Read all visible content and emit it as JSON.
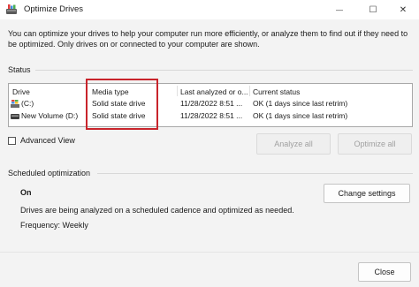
{
  "window": {
    "title": "Optimize Drives",
    "minimize_glyph": "—",
    "maximize_glyph": "☐",
    "close_glyph": "✕"
  },
  "intro_text": "You can optimize your drives to help your computer run more efficiently, or analyze them to find out if they need to be optimized. Only drives on or connected to your computer are shown.",
  "status": {
    "section_label": "Status",
    "columns": [
      "Drive",
      "Media type",
      "Last analyzed or o...",
      "Current status"
    ],
    "rows": [
      {
        "drive": "(C:)",
        "drive_icon": "windows-drive-icon",
        "media_type": "Solid state drive",
        "last_analyzed": "11/28/2022 8:51 ...",
        "current_status": "OK (1 days since last retrim)"
      },
      {
        "drive": "New Volume (D:)",
        "drive_icon": "drive-icon",
        "media_type": "Solid state drive",
        "last_analyzed": "11/28/2022 8:51 ...",
        "current_status": "OK (1 days since last retrim)"
      }
    ],
    "highlight_color": "#c8242b"
  },
  "advanced_view": {
    "label": "Advanced View",
    "checked": false
  },
  "buttons": {
    "analyze_all": "Analyze all",
    "optimize_all": "Optimize all",
    "change_settings": "Change settings",
    "close": "Close"
  },
  "scheduled": {
    "section_label": "Scheduled optimization",
    "state": "On",
    "description": "Drives are being analyzed on a scheduled cadence and optimized as needed.",
    "frequency": "Frequency: Weekly"
  }
}
